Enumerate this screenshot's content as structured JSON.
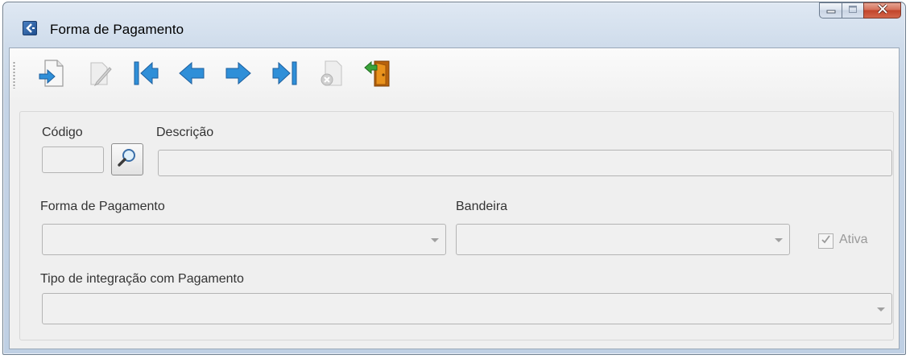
{
  "window": {
    "title": "Forma de Pagamento",
    "app_icon": "back-arrow-icon",
    "controls": {
      "minimize": "minimize-icon",
      "maximize": "maximize-icon",
      "close": "close-icon"
    }
  },
  "toolbar": {
    "buttons": [
      {
        "name": "new-record-button",
        "icon": "new-document-icon",
        "enabled": true
      },
      {
        "name": "edit-button",
        "icon": "edit-pencil-icon",
        "enabled": false
      },
      {
        "name": "first-record-button",
        "icon": "first-record-icon",
        "enabled": true
      },
      {
        "name": "previous-record-button",
        "icon": "previous-arrow-icon",
        "enabled": true
      },
      {
        "name": "next-record-button",
        "icon": "next-arrow-icon",
        "enabled": true
      },
      {
        "name": "last-record-button",
        "icon": "last-record-icon",
        "enabled": true
      },
      {
        "name": "delete-button",
        "icon": "delete-document-icon",
        "enabled": false
      },
      {
        "name": "exit-button",
        "icon": "exit-door-icon",
        "enabled": true
      }
    ]
  },
  "form": {
    "codigo": {
      "label": "Código",
      "value": ""
    },
    "descricao": {
      "label": "Descrição",
      "value": ""
    },
    "forma_pagamento": {
      "label": "Forma de Pagamento",
      "value": ""
    },
    "bandeira": {
      "label": "Bandeira",
      "value": ""
    },
    "ativa": {
      "label": "Ativa",
      "checked": true,
      "enabled": false
    },
    "tipo_integracao": {
      "label": "Tipo de integração com Pagamento",
      "value": ""
    }
  },
  "colors": {
    "accent_blue": "#2f8fd8",
    "disabled_gray": "#9a9a9a",
    "door_orange": "#d9860f"
  }
}
